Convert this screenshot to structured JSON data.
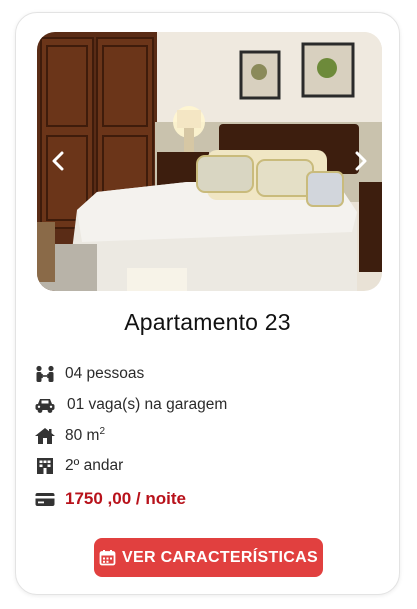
{
  "listing": {
    "title": "Apartamento 23",
    "features": [
      {
        "icon": "people-icon",
        "text": "04 pessoas"
      },
      {
        "icon": "car-icon",
        "text": "01 vaga(s) na garagem"
      },
      {
        "icon": "house-icon",
        "text": "80 m",
        "sup": "2"
      },
      {
        "icon": "building-icon",
        "text": "2º andar"
      },
      {
        "icon": "credit-card-icon",
        "text": "1750 ,00 / noite"
      }
    ],
    "button_label": "VER CARACTERÍSTICAS"
  },
  "carousel": {
    "prev_icon": "chevron-left-icon",
    "next_icon": "chevron-right-icon"
  },
  "colors": {
    "price": "#b8121b",
    "button": "#e1403f"
  }
}
